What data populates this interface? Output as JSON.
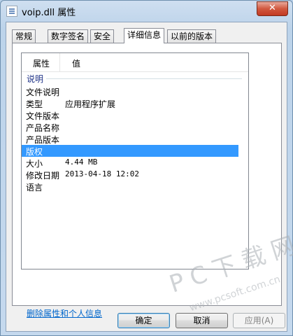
{
  "window": {
    "title": "voip.dll 属性",
    "close_glyph": "✕"
  },
  "tabs": [
    {
      "label": "常规"
    },
    {
      "label": "数字签名"
    },
    {
      "label": "安全"
    },
    {
      "label": "详细信息"
    },
    {
      "label": "以前的版本"
    }
  ],
  "details": {
    "columns": {
      "property": "属性",
      "value": "值"
    },
    "group": "说明",
    "rows": [
      {
        "name": "文件说明",
        "value": ""
      },
      {
        "name": "类型",
        "value": "应用程序扩展"
      },
      {
        "name": "文件版本",
        "value": ""
      },
      {
        "name": "产品名称",
        "value": ""
      },
      {
        "name": "产品版本",
        "value": ""
      },
      {
        "name": "版权",
        "value": ""
      },
      {
        "name": "大小",
        "value": "4.44 MB"
      },
      {
        "name": "修改日期",
        "value": "2013-04-18 12:02"
      },
      {
        "name": "语言",
        "value": ""
      }
    ]
  },
  "remove_link": "删除属性和个人信息",
  "buttons": {
    "ok": "确定",
    "cancel": "取消",
    "apply": "应用(A)"
  },
  "watermark": {
    "main": "PC下载网",
    "sub": "www.pcsoft.com.cn"
  }
}
